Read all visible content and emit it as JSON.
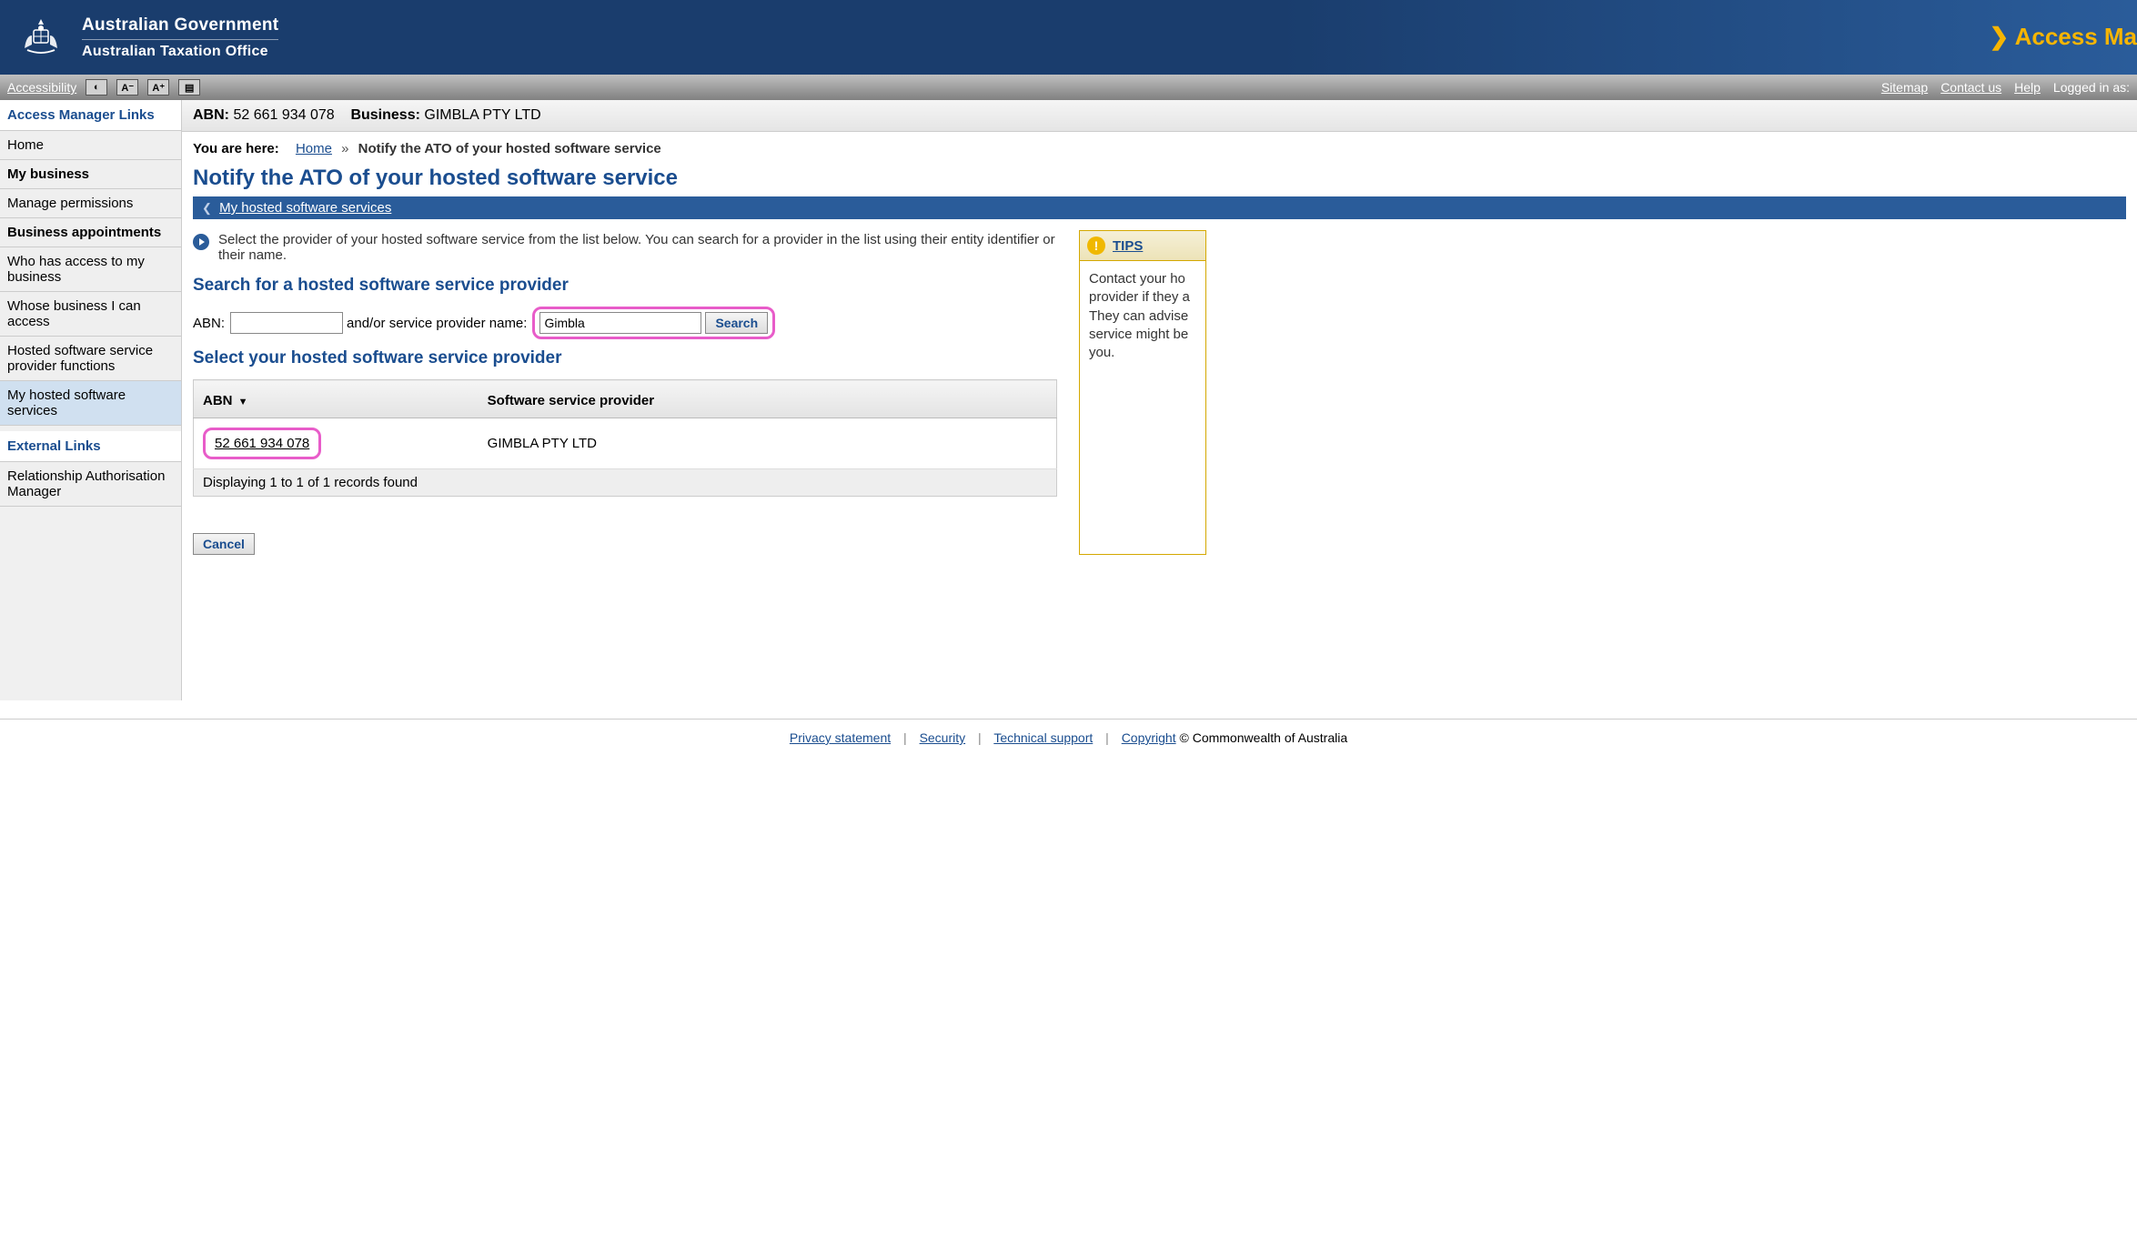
{
  "header": {
    "gov_line": "Australian Government",
    "ato_line": "Australian Taxation Office",
    "app_title": "Access Ma"
  },
  "utility": {
    "accessibility": "Accessibility",
    "contrast_label": "◐",
    "text_decrease": "A⁻",
    "text_increase": "A⁺",
    "sitemap": "Sitemap",
    "contact": "Contact us",
    "help": "Help",
    "logged_in": "Logged in as:"
  },
  "sidebar": {
    "section1_title": "Access Manager Links",
    "items1": [
      {
        "label": "Home",
        "bold": false,
        "active": false
      },
      {
        "label": "My business",
        "bold": true,
        "active": false
      },
      {
        "label": "Manage permissions",
        "bold": false,
        "active": false
      },
      {
        "label": "Business appointments",
        "bold": true,
        "active": false
      },
      {
        "label": "Who has access to my business",
        "bold": false,
        "active": false
      },
      {
        "label": "Whose business I can access",
        "bold": false,
        "active": false
      },
      {
        "label": "Hosted software service provider functions",
        "bold": false,
        "active": false
      },
      {
        "label": "My hosted software services",
        "bold": false,
        "active": true
      }
    ],
    "section2_title": "External Links",
    "items2": [
      {
        "label": "Relationship Authorisation Manager",
        "bold": false,
        "active": false
      }
    ]
  },
  "context": {
    "abn_label": "ABN:",
    "abn_value": "52 661 934 078",
    "business_label": "Business:",
    "business_value": "GIMBLA PTY LTD"
  },
  "breadcrumb": {
    "you_are_here": "You are here:",
    "home": "Home",
    "current": "Notify the ATO of your hosted software service"
  },
  "page_title": "Notify the ATO of your hosted software service",
  "nav_strip": {
    "back_label": "My hosted software services"
  },
  "instruction": "Select the provider of your hosted software service from the list below. You can search for a provider in the list using their entity identifier or their name.",
  "search": {
    "heading": "Search for a hosted software service provider",
    "abn_label": "ABN:",
    "abn_value": "",
    "andor_label": "and/or service provider name:",
    "name_value": "Gimbla",
    "search_btn": "Search"
  },
  "results": {
    "heading": "Select your hosted software service provider",
    "col_abn": "ABN",
    "col_provider": "Software service provider",
    "rows": [
      {
        "abn": "52 661 934 078",
        "provider": "GIMBLA PTY LTD"
      }
    ],
    "footer": "Displaying 1 to 1 of 1 records found"
  },
  "cancel_btn": "Cancel",
  "tips": {
    "title": "TIPS",
    "body": "Contact your ho\nprovider if they a\nThey can advise\nservice might be\nyou."
  },
  "footer": {
    "privacy": "Privacy statement",
    "security": "Security",
    "technical": "Technical support",
    "copyright_link": "Copyright",
    "copyright_rest": " © Commonwealth of Australia"
  }
}
